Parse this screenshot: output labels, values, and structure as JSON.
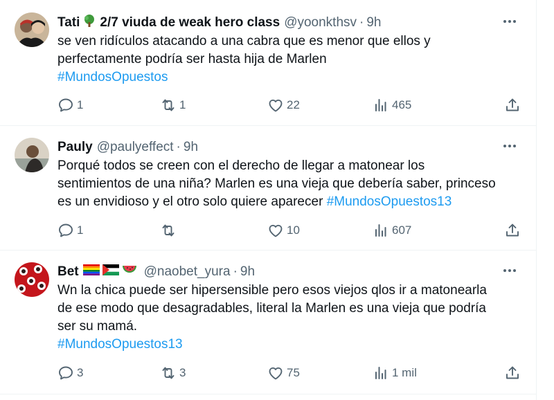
{
  "tweets": [
    {
      "name": "Tati",
      "name_suffix": "2/7 viuda de weak hero class",
      "handle": "@yoonkthsv",
      "dot": "·",
      "time": "9h",
      "lines": [
        "se ven ridículos atacando a una cabra que es menor que ellos y",
        "perfectamente podría ser hasta hija de Marlen"
      ],
      "hashtag": "#MundosOpuestos",
      "replies": "1",
      "retweets": "1",
      "likes": "22",
      "views": "465",
      "avatar_colors": [
        "#c9b59a",
        "#1a1a1a",
        "#b8322a"
      ]
    },
    {
      "name": "Pauly",
      "handle": "@paulyeffect",
      "dot": "·",
      "time": "9h",
      "lines": [
        "Porqué todos se creen con el derecho de llegar a matonear los",
        "sentimientos de una niña? Marlen es una vieja que debería saber, princeso",
        "es un envidioso y el otro solo quiere aparecer "
      ],
      "hashtag": "#MundosOpuestos13",
      "replies": "1",
      "retweets": "",
      "likes": "10",
      "views": "607",
      "avatar_colors": [
        "#d9d2c5",
        "#5a4a3a"
      ]
    },
    {
      "name": "Bet",
      "handle": "@naobet_yura",
      "dot": "·",
      "time": "9h",
      "lines": [
        "Wn la chica puede ser hipersensible pero esos viejos qlos ir a matonearla",
        "de ese modo que desagradables, literal la Marlen es una vieja que podría",
        "ser su mamá."
      ],
      "hashtag": "#MundosOpuestos13",
      "replies": "3",
      "retweets": "3",
      "likes": "75",
      "views": "1 mil",
      "avatar_colors": [
        "#c4161c",
        "#ffffff"
      ]
    }
  ],
  "colors": {
    "text": "#0f1419",
    "secondary": "#536471",
    "link": "#1d9bf0",
    "divider": "#eff3f4"
  },
  "icons": [
    "reply-icon",
    "retweet-icon",
    "like-icon",
    "views-icon",
    "share-icon",
    "more-icon",
    "tree-emoji-icon",
    "rainbow-flag-icon",
    "palestine-flag-icon",
    "watermelon-icon"
  ]
}
